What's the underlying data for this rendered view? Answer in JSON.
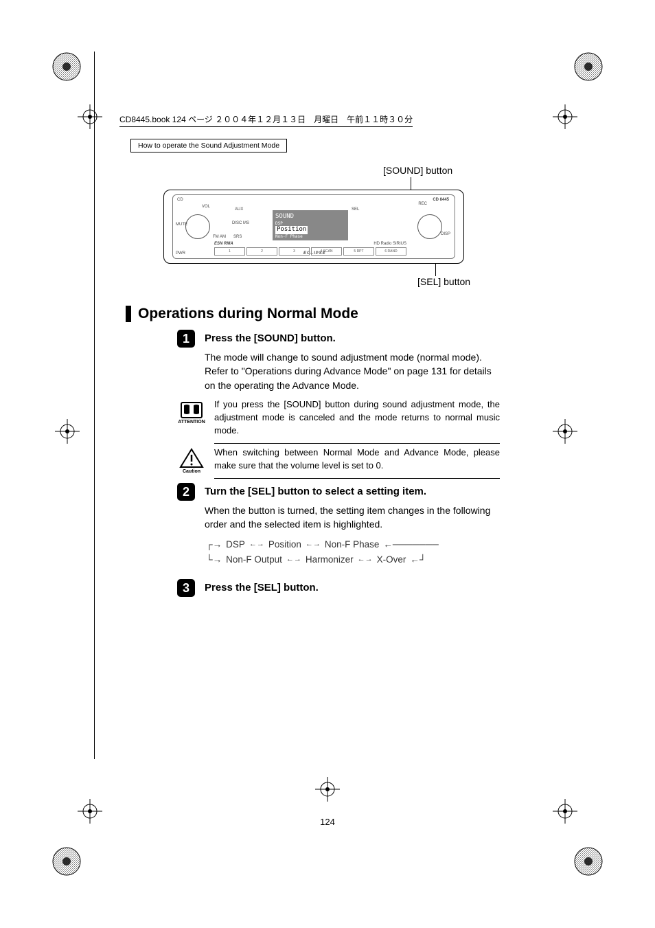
{
  "book_header": "CD8445.book  124 ページ  ２００４年１２月１３日　月曜日　午前１１時３０分",
  "section_header": "How to operate the Sound Adjustment Mode",
  "callouts": {
    "sound": "[SOUND] button",
    "sel": "[SEL] button"
  },
  "device": {
    "model": "CD 8445",
    "screen_line1": "SOUND",
    "screen_sub": "DSP",
    "screen_line2": "Position",
    "screen_line3": "Non-F Phase",
    "brand": "ECLIPSE",
    "esn": "ESN RMA",
    "labels": [
      "CD",
      "VOL",
      "AUX",
      "DISC MS",
      "MUTE",
      "FM AM",
      "SRS",
      "SEL",
      "REC",
      "DISP",
      "PWR"
    ],
    "buttons": [
      "1",
      "2",
      "3",
      "4 SCAN",
      "5 RPT",
      "6 RAND"
    ],
    "logos": "HD Radio  SIRIUS"
  },
  "heading": "Operations during Normal Mode",
  "steps": {
    "s1": {
      "num": "1",
      "title": "Press the [SOUND] button.",
      "body": "The mode will change to sound adjustment mode (normal mode). Refer to \"Operations during Advance Mode\" on page 131 for details on the operating the Advance Mode."
    },
    "s2": {
      "num": "2",
      "title": "Turn the [SEL] button to select a setting item.",
      "body": "When the button is turned, the setting item changes in the following order and the selected item is highlighted."
    },
    "s3": {
      "num": "3",
      "title": "Press the [SEL] button."
    }
  },
  "notes": {
    "attention_label": "ATTENTION",
    "attention": "If you press the [SOUND] button during sound adjustment mode, the adjustment mode is canceled and the mode returns to normal music mode.",
    "caution_label": "Caution",
    "caution": "When switching between Normal Mode and Advance Mode, please make sure that the volume level is set to 0."
  },
  "cycle": {
    "items": [
      "DSP",
      "Position",
      "Non-F Phase",
      "Non-F Output",
      "Harmonizer",
      "X-Over"
    ]
  },
  "page_num": "124"
}
